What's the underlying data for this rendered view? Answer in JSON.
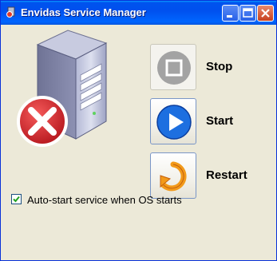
{
  "window": {
    "title": "Envidas Service Manager",
    "controls": {
      "minimize": "minimize",
      "maximize": "maximize",
      "close": "close"
    }
  },
  "illustration": {
    "icon": "server-stopped-icon",
    "status_color": "#d4202a"
  },
  "actions": [
    {
      "id": "stop",
      "label": "Stop",
      "icon": "stop-icon",
      "enabled": false
    },
    {
      "id": "start",
      "label": "Start",
      "icon": "play-icon",
      "enabled": true,
      "color": "#1d6fe0"
    },
    {
      "id": "restart",
      "label": "Restart",
      "icon": "restart-icon",
      "enabled": true,
      "color": "#f29a1a"
    }
  ],
  "options": {
    "autostart": {
      "label": "Auto-start service when OS starts",
      "checked": true
    }
  },
  "colors": {
    "titlebar": "#0055ea",
    "background": "#ece9d8",
    "accent": "#1d6fe0"
  }
}
